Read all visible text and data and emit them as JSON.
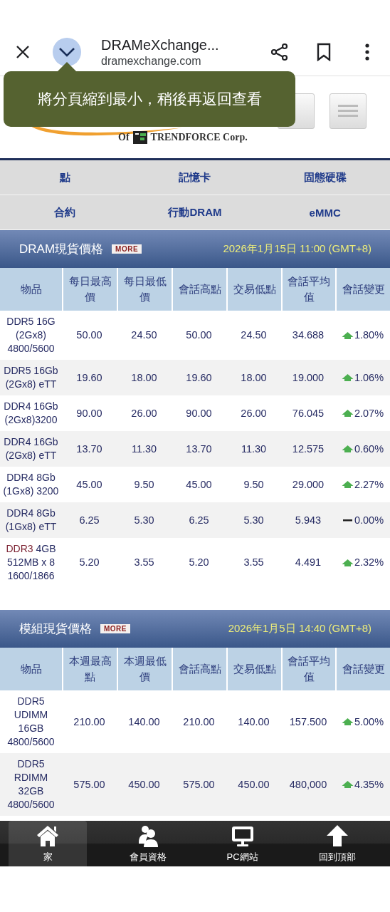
{
  "toolbar": {
    "title": "DRAMeXchange...",
    "url": "dramexchange.com"
  },
  "tooltip": "將分頁縮到最小，稍後再返回查看",
  "logo": {
    "of": "Of",
    "company": "TRENDFORCE Corp."
  },
  "categories": [
    {
      "label": "點"
    },
    {
      "label": "記憶卡"
    },
    {
      "label": "固態硬碟"
    },
    {
      "label": "合約"
    },
    {
      "label": "行動DRAM"
    },
    {
      "label": "eMMC"
    }
  ],
  "sections": [
    {
      "title": "DRAM現貨價格",
      "more": "MORE",
      "date": "2026年1月15日 11:00 (GMT+8)",
      "columns": [
        "物品",
        "每日最高價",
        "每日最低價",
        "會話高點",
        "交易低點",
        "會話平均值",
        "會話變更"
      ],
      "rows": [
        {
          "item": "DDR5 16G\n(2Gx8)\n4800/5600",
          "values": [
            "50.00",
            "24.50",
            "50.00",
            "24.50",
            "34.688"
          ],
          "kind": "up",
          "change": "1.80%"
        },
        {
          "item": "DDR5 16Gb\n(2Gx8) eTT",
          "values": [
            "19.60",
            "18.00",
            "19.60",
            "18.00",
            "19.000"
          ],
          "kind": "up",
          "change": "1.06%"
        },
        {
          "item": "DDR4 16Gb\n(2Gx8)3200",
          "values": [
            "90.00",
            "26.00",
            "90.00",
            "26.00",
            "76.045"
          ],
          "kind": "up",
          "change": "2.07%"
        },
        {
          "item": "DDR4 16Gb\n(2Gx8) eTT",
          "values": [
            "13.70",
            "11.30",
            "13.70",
            "11.30",
            "12.575"
          ],
          "kind": "up",
          "change": "0.60%"
        },
        {
          "item": "DDR4 8Gb\n(1Gx8) 3200",
          "values": [
            "45.00",
            "9.50",
            "45.00",
            "9.50",
            "29.000"
          ],
          "kind": "up",
          "change": "2.27%"
        },
        {
          "item": "DDR4 8Gb\n(1Gx8) eTT",
          "values": [
            "6.25",
            "5.30",
            "6.25",
            "5.30",
            "5.943"
          ],
          "kind": "flat",
          "change": "0.00%"
        },
        {
          "item_accent": "DDR3",
          "item": " 4GB\n512MB x 8\n1600/1866",
          "values": [
            "5.20",
            "3.55",
            "5.20",
            "3.55",
            "4.491"
          ],
          "kind": "up",
          "change": "2.32%"
        }
      ]
    },
    {
      "title": "模組現貨價格",
      "more": "MORE",
      "date": "2026年1月5日 14:40 (GMT+8)",
      "columns": [
        "物品",
        "本週最高點",
        "本週最低價",
        "會話高點",
        "交易低點",
        "會話平均值",
        "會話變更"
      ],
      "rows": [
        {
          "item": "DDR5\nUDIMM\n16GB\n4800/5600",
          "values": [
            "210.00",
            "140.00",
            "210.00",
            "140.00",
            "157.500"
          ],
          "kind": "up",
          "change": "5.00%"
        },
        {
          "item": "DDR5\nRDIMM\n32GB\n4800/5600",
          "values": [
            "575.00",
            "450.00",
            "575.00",
            "450.00",
            "480,000"
          ],
          "kind": "up",
          "change": "4.35%"
        }
      ]
    }
  ],
  "bottom_nav": [
    {
      "kind": "home",
      "label": "家",
      "selected": true
    },
    {
      "kind": "members",
      "label": "會員資格",
      "selected": false
    },
    {
      "kind": "pc",
      "label": "PC網站",
      "selected": false
    },
    {
      "kind": "top",
      "label": "回到頂部",
      "selected": false
    }
  ]
}
